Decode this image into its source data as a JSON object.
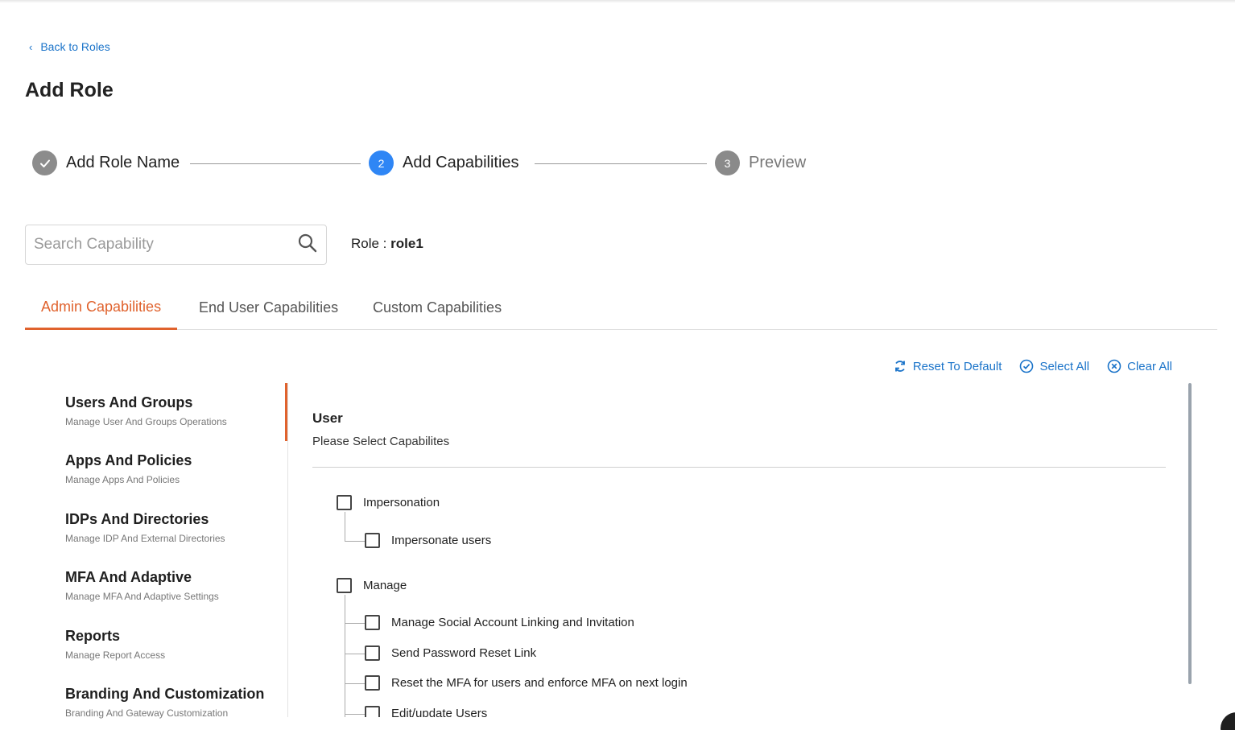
{
  "nav": {
    "back_label": "Back to Roles"
  },
  "page": {
    "title": "Add Role"
  },
  "stepper": {
    "steps": [
      {
        "number": "",
        "label": "Add Role Name",
        "state": "done"
      },
      {
        "number": "2",
        "label": "Add Capabilities",
        "state": "active"
      },
      {
        "number": "3",
        "label": "Preview",
        "state": "pending"
      }
    ]
  },
  "search": {
    "placeholder": "Search Capability",
    "value": ""
  },
  "role": {
    "prefix": "Role : ",
    "name": "role1"
  },
  "tabs": [
    {
      "label": "Admin Capabilities",
      "active": true
    },
    {
      "label": "End User Capabilities",
      "active": false
    },
    {
      "label": "Custom Capabilities",
      "active": false
    }
  ],
  "actions": {
    "reset_label": "Reset To Default",
    "select_all_label": "Select All",
    "clear_all_label": "Clear All"
  },
  "categories": [
    {
      "title": "Users And Groups",
      "subtitle": "Manage User And Groups Operations"
    },
    {
      "title": "Apps And Policies",
      "subtitle": "Manage Apps And Policies"
    },
    {
      "title": "IDPs And Directories",
      "subtitle": "Manage IDP And External Directories"
    },
    {
      "title": "MFA And Adaptive",
      "subtitle": "Manage MFA And Adaptive Settings"
    },
    {
      "title": "Reports",
      "subtitle": "Manage Report Access"
    },
    {
      "title": "Branding And Customization",
      "subtitle": "Branding And Gateway Customization"
    }
  ],
  "panel": {
    "title": "User",
    "subtitle": "Please Select Capabilites",
    "groups": [
      {
        "label": "Impersonation",
        "items": [
          "Impersonate users"
        ]
      },
      {
        "label": "Manage",
        "items": [
          "Manage Social Account Linking and Invitation",
          "Send Password Reset Link",
          "Reset the MFA for users and enforce MFA on next login",
          "Edit/update Users"
        ]
      }
    ]
  },
  "colors": {
    "accent": "#e0622d",
    "link": "#1a73c9",
    "active_step": "#2f86f5"
  },
  "icons": {
    "back": "chevron-left-icon",
    "done_step": "check-icon",
    "search": "search-icon",
    "reset": "refresh-icon",
    "select_all": "check-circle-icon",
    "clear_all": "close-circle-icon"
  }
}
